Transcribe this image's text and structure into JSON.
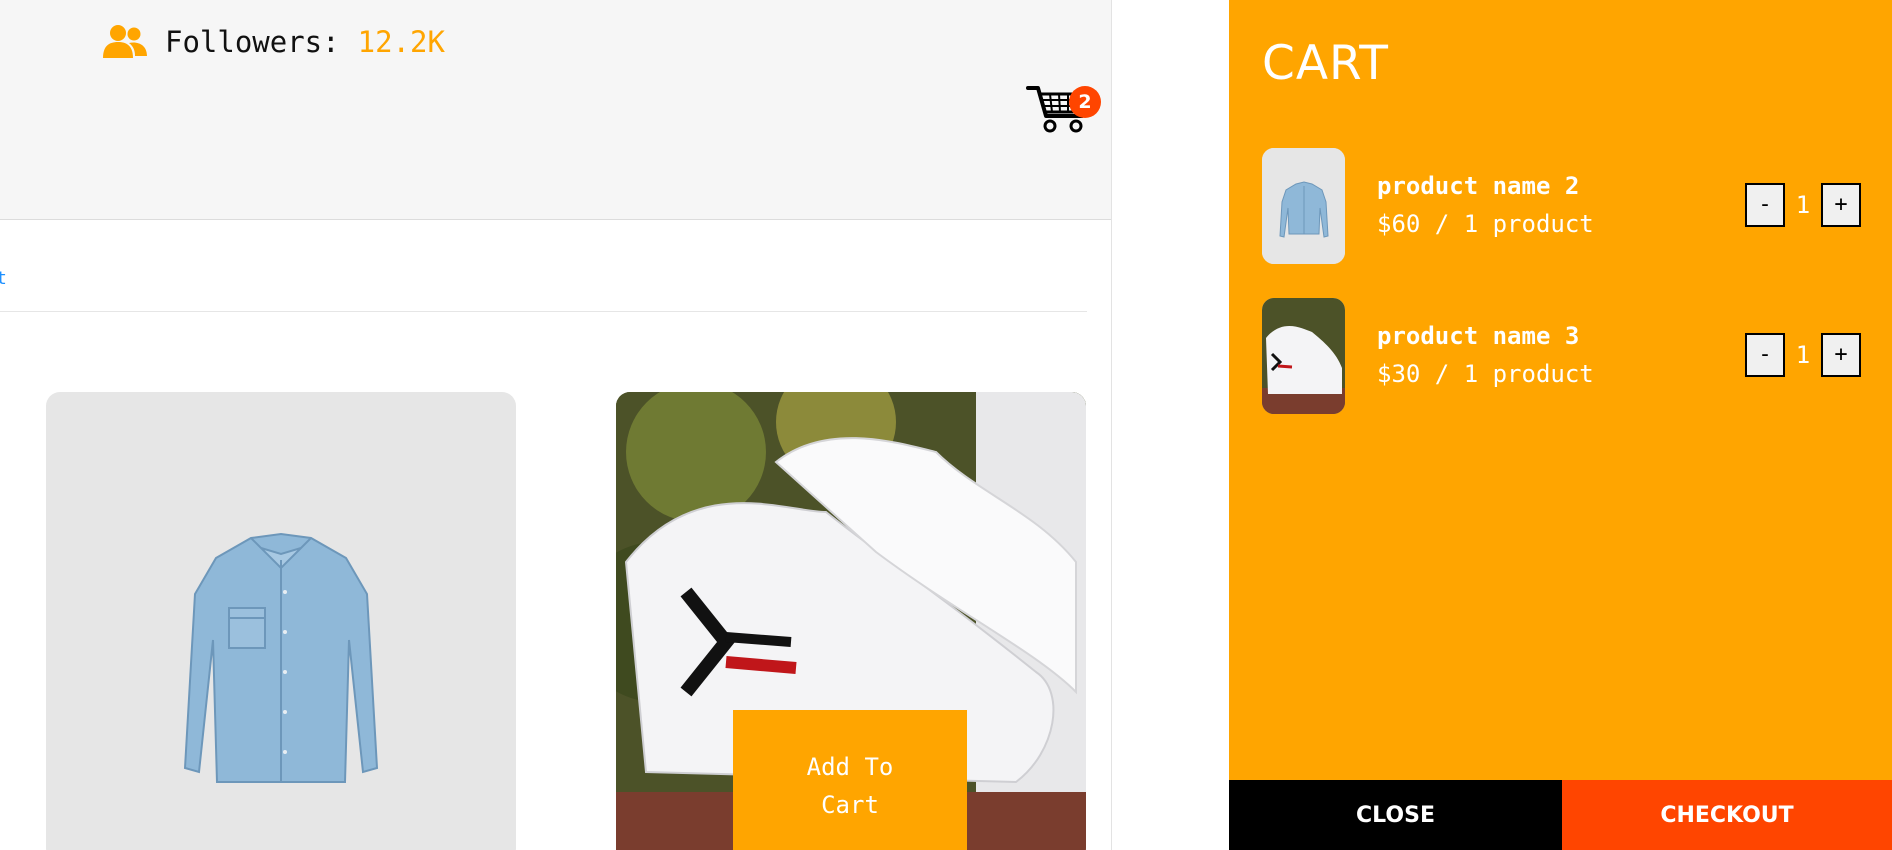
{
  "profile": {
    "followers_label": "Followers:",
    "followers_value": "12.2K",
    "followers_icon": "users-icon"
  },
  "header": {
    "cart_icon": "shopping-cart-icon",
    "cart_count": "2",
    "badge_color": "#ff4500"
  },
  "tabs": {
    "visible_link_fragment": "t",
    "link_color": "#1e90ff"
  },
  "products": [
    {
      "image": "denim-shirt",
      "button_label": ""
    },
    {
      "image": "white-sneakers",
      "button_label": "Add To Cart"
    }
  ],
  "cart": {
    "title": "CART",
    "accent_color": "#ffa500",
    "items": [
      {
        "name": "product name 2",
        "price": "$60 / 1 product",
        "quantity": "1",
        "decrement_label": "-",
        "increment_label": "+"
      },
      {
        "name": "product name 3",
        "price": "$30 / 1 product",
        "quantity": "1",
        "decrement_label": "-",
        "increment_label": "+"
      }
    ],
    "close_label": "CLOSE",
    "checkout_label": "CHECKOUT",
    "checkout_color": "#ff4500"
  }
}
